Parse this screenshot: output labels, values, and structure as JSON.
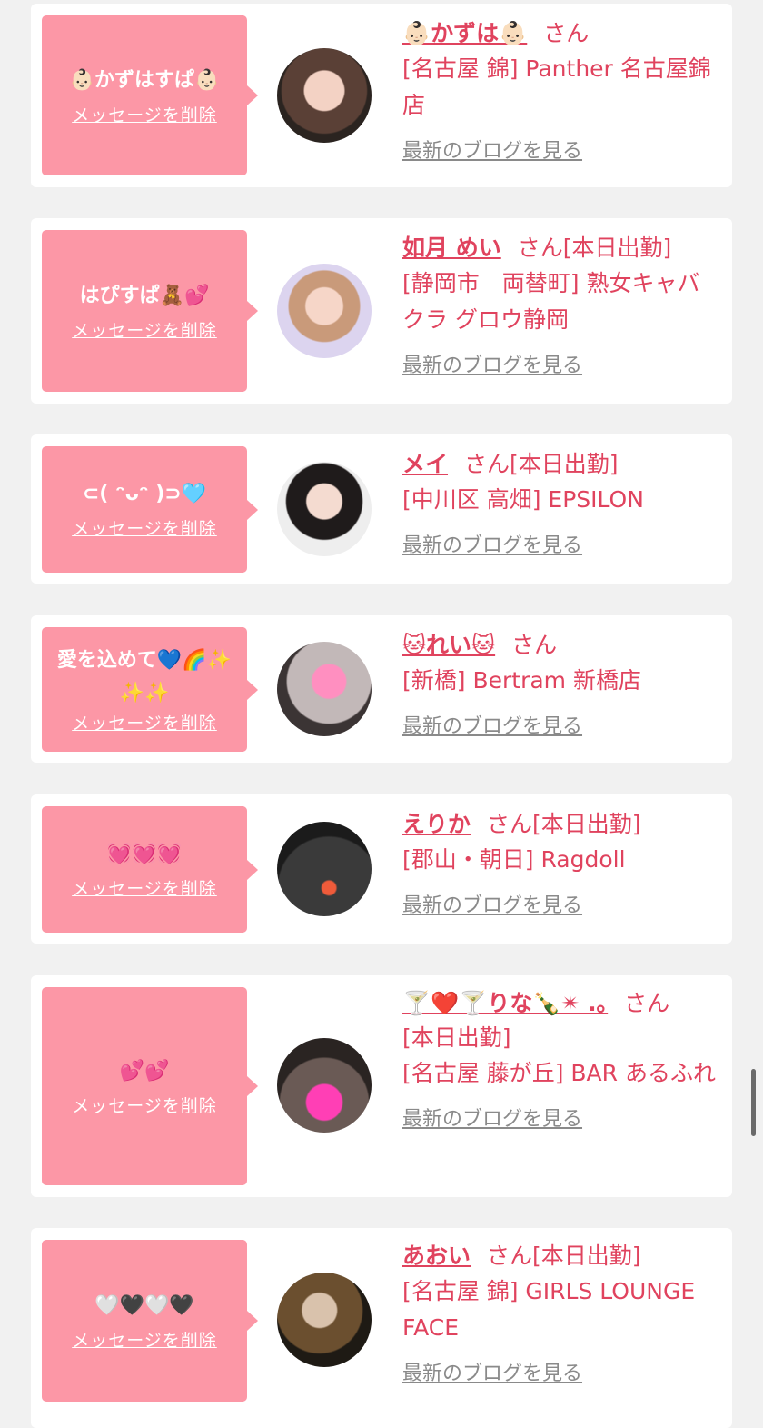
{
  "delete_label": "メッセージを削除",
  "blog_label": "最新のブログを見る",
  "san_label": "さん",
  "accent_color": "#e0435e",
  "bubble_color": "#fc97a6",
  "items": [
    {
      "message": "👶🏻かずはすぱ👶🏻",
      "name": "👶🏻かずは👶🏻",
      "status": "",
      "shop": "[名古屋 錦] Panther 名古屋錦店"
    },
    {
      "message": "はぴすぱ🧸💕",
      "name": "如月 めい",
      "status": "[本日出勤]",
      "shop": "[静岡市　両替町] 熟女キャバクラ グロウ静岡"
    },
    {
      "message": "⊂( ᵔᴗᵔ )⊃🩵",
      "name": "メイ",
      "status": "[本日出勤]",
      "shop": "[中川区 高畑] EPSILON"
    },
    {
      "message": "愛を込めて💙🌈✨✨✨",
      "name": "🐱れい🐱",
      "status": "",
      "shop": "[新橋] Bertram 新橋店"
    },
    {
      "message": "💓💓💓",
      "name": "えりか",
      "status": "[本日出勤]",
      "shop": "[郡山・朝日] Ragdoll"
    },
    {
      "message": "💕💕",
      "name": "🍸❤️🍸りな🍾✴︎ .｡",
      "status": "[本日出勤]",
      "shop": "[名古屋 藤が丘] BAR あるふれ"
    },
    {
      "message": "🤍🖤🤍🖤",
      "name": "あおい",
      "status": "[本日出勤]",
      "shop": "[名古屋 錦] GIRLS LOUNGE FACE"
    }
  ]
}
